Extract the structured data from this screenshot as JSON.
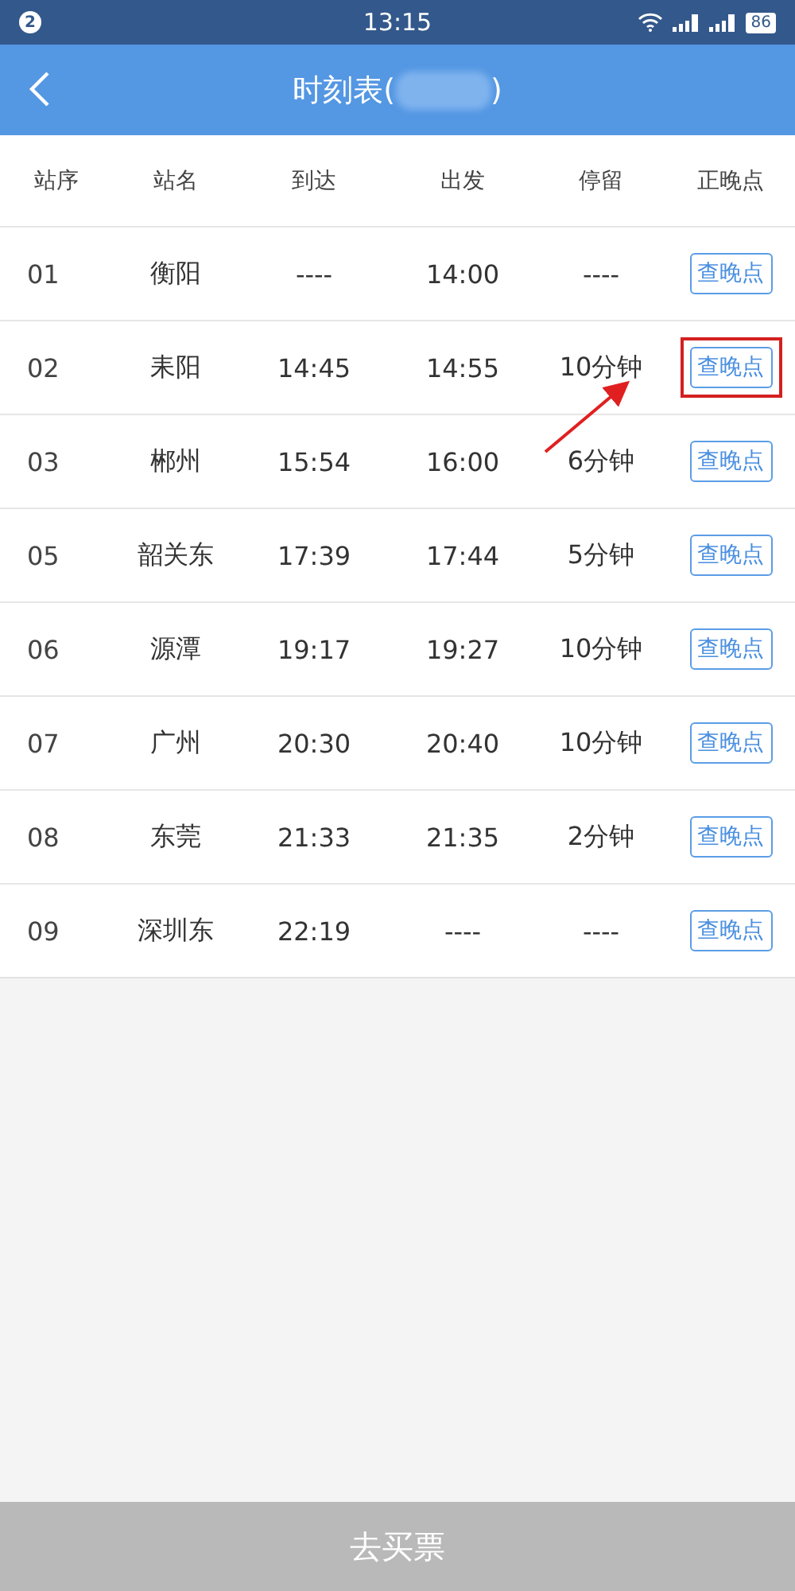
{
  "status_bar": {
    "notification_count": "2",
    "time": "13:15",
    "battery": "86"
  },
  "header": {
    "title_open": "时刻表(",
    "title_close": ")",
    "title_redacted": true
  },
  "table": {
    "columns": [
      "站序",
      "站名",
      "到达",
      "出发",
      "停留",
      "正晚点"
    ],
    "rows": [
      {
        "no": "01",
        "station": "衡阳",
        "arrive": "----",
        "depart": "14:00",
        "stop": "----",
        "action": "查晚点",
        "highlighted": false
      },
      {
        "no": "02",
        "station": "耒阳",
        "arrive": "14:45",
        "depart": "14:55",
        "stop": "10分钟",
        "action": "查晚点",
        "highlighted": true
      },
      {
        "no": "03",
        "station": "郴州",
        "arrive": "15:54",
        "depart": "16:00",
        "stop": "6分钟",
        "action": "查晚点",
        "highlighted": false
      },
      {
        "no": "05",
        "station": "韶关东",
        "arrive": "17:39",
        "depart": "17:44",
        "stop": "5分钟",
        "action": "查晚点",
        "highlighted": false
      },
      {
        "no": "06",
        "station": "源潭",
        "arrive": "19:17",
        "depart": "19:27",
        "stop": "10分钟",
        "action": "查晚点",
        "highlighted": false
      },
      {
        "no": "07",
        "station": "广州",
        "arrive": "20:30",
        "depart": "20:40",
        "stop": "10分钟",
        "action": "查晚点",
        "highlighted": false
      },
      {
        "no": "08",
        "station": "东莞",
        "arrive": "21:33",
        "depart": "21:35",
        "stop": "2分钟",
        "action": "查晚点",
        "highlighted": false
      },
      {
        "no": "09",
        "station": "深圳东",
        "arrive": "22:19",
        "depart": "----",
        "stop": "----",
        "action": "查晚点",
        "highlighted": false
      }
    ]
  },
  "footer": {
    "button": "去买票"
  }
}
